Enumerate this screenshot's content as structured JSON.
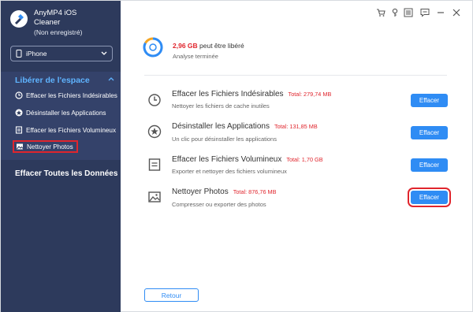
{
  "app": {
    "name": "AnyMP4 iOS",
    "name2": "Cleaner",
    "status": "(Non enregistré)"
  },
  "sidebar": {
    "device": "iPhone",
    "section_title": "Libérer de l'espace",
    "items": [
      {
        "label": "Effacer les Fichiers Indésirables",
        "icon": "clock-icon"
      },
      {
        "label": "Désinstaller les Applications",
        "icon": "star-icon"
      },
      {
        "label": "Effacer les Fichiers Volumineux",
        "icon": "file-icon"
      },
      {
        "label": "Nettoyer Photos",
        "icon": "photo-icon",
        "active": true
      }
    ],
    "erase_all": "Effacer Toutes les Données"
  },
  "summary": {
    "size": "2,96 GB",
    "text": " peut être libéré",
    "status": "Analyse terminée"
  },
  "rows": [
    {
      "title": "Effacer les Fichiers Indésirables",
      "total": "Total: 279,74 MB",
      "desc": "Nettoyer les fichiers de cache inutiles",
      "button": "Effacer",
      "icon": "clock-icon"
    },
    {
      "title": "Désinstaller les Applications",
      "total": "Total: 131,85 MB",
      "desc": "Un clic pour désinstaller les applications",
      "button": "Effacer",
      "icon": "star-icon"
    },
    {
      "title": "Effacer les Fichiers Volumineux",
      "total": "Total: 1,70 GB",
      "desc": "Exporter et nettoyer des fichiers volumineux",
      "button": "Effacer",
      "icon": "file-icon"
    },
    {
      "title": "Nettoyer Photos",
      "total": "Total: 876,76 MB",
      "desc": "Compresser ou exporter des photos",
      "button": "Effacer",
      "icon": "photo-icon"
    }
  ],
  "footer": {
    "back_label": "Retour"
  },
  "colors": {
    "sidebar": "#2d3a5c",
    "accent": "#2f8cf4",
    "highlight": "#e0252d",
    "section_title": "#5fb4ff"
  }
}
